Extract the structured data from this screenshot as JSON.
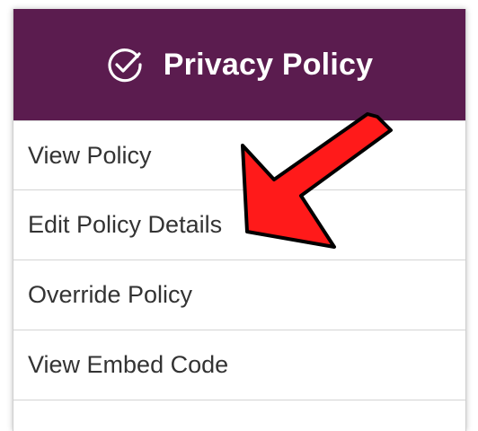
{
  "header": {
    "title": "Privacy Policy",
    "icon": "check-circle-icon",
    "background_color": "#5b1c4f"
  },
  "menu": {
    "items": [
      {
        "label": "View Policy"
      },
      {
        "label": "Edit Policy Details"
      },
      {
        "label": "Override Policy"
      },
      {
        "label": "View Embed Code"
      }
    ]
  },
  "annotation": {
    "arrow_color": "#ff1a1a",
    "points_to": "Edit Policy Details"
  }
}
